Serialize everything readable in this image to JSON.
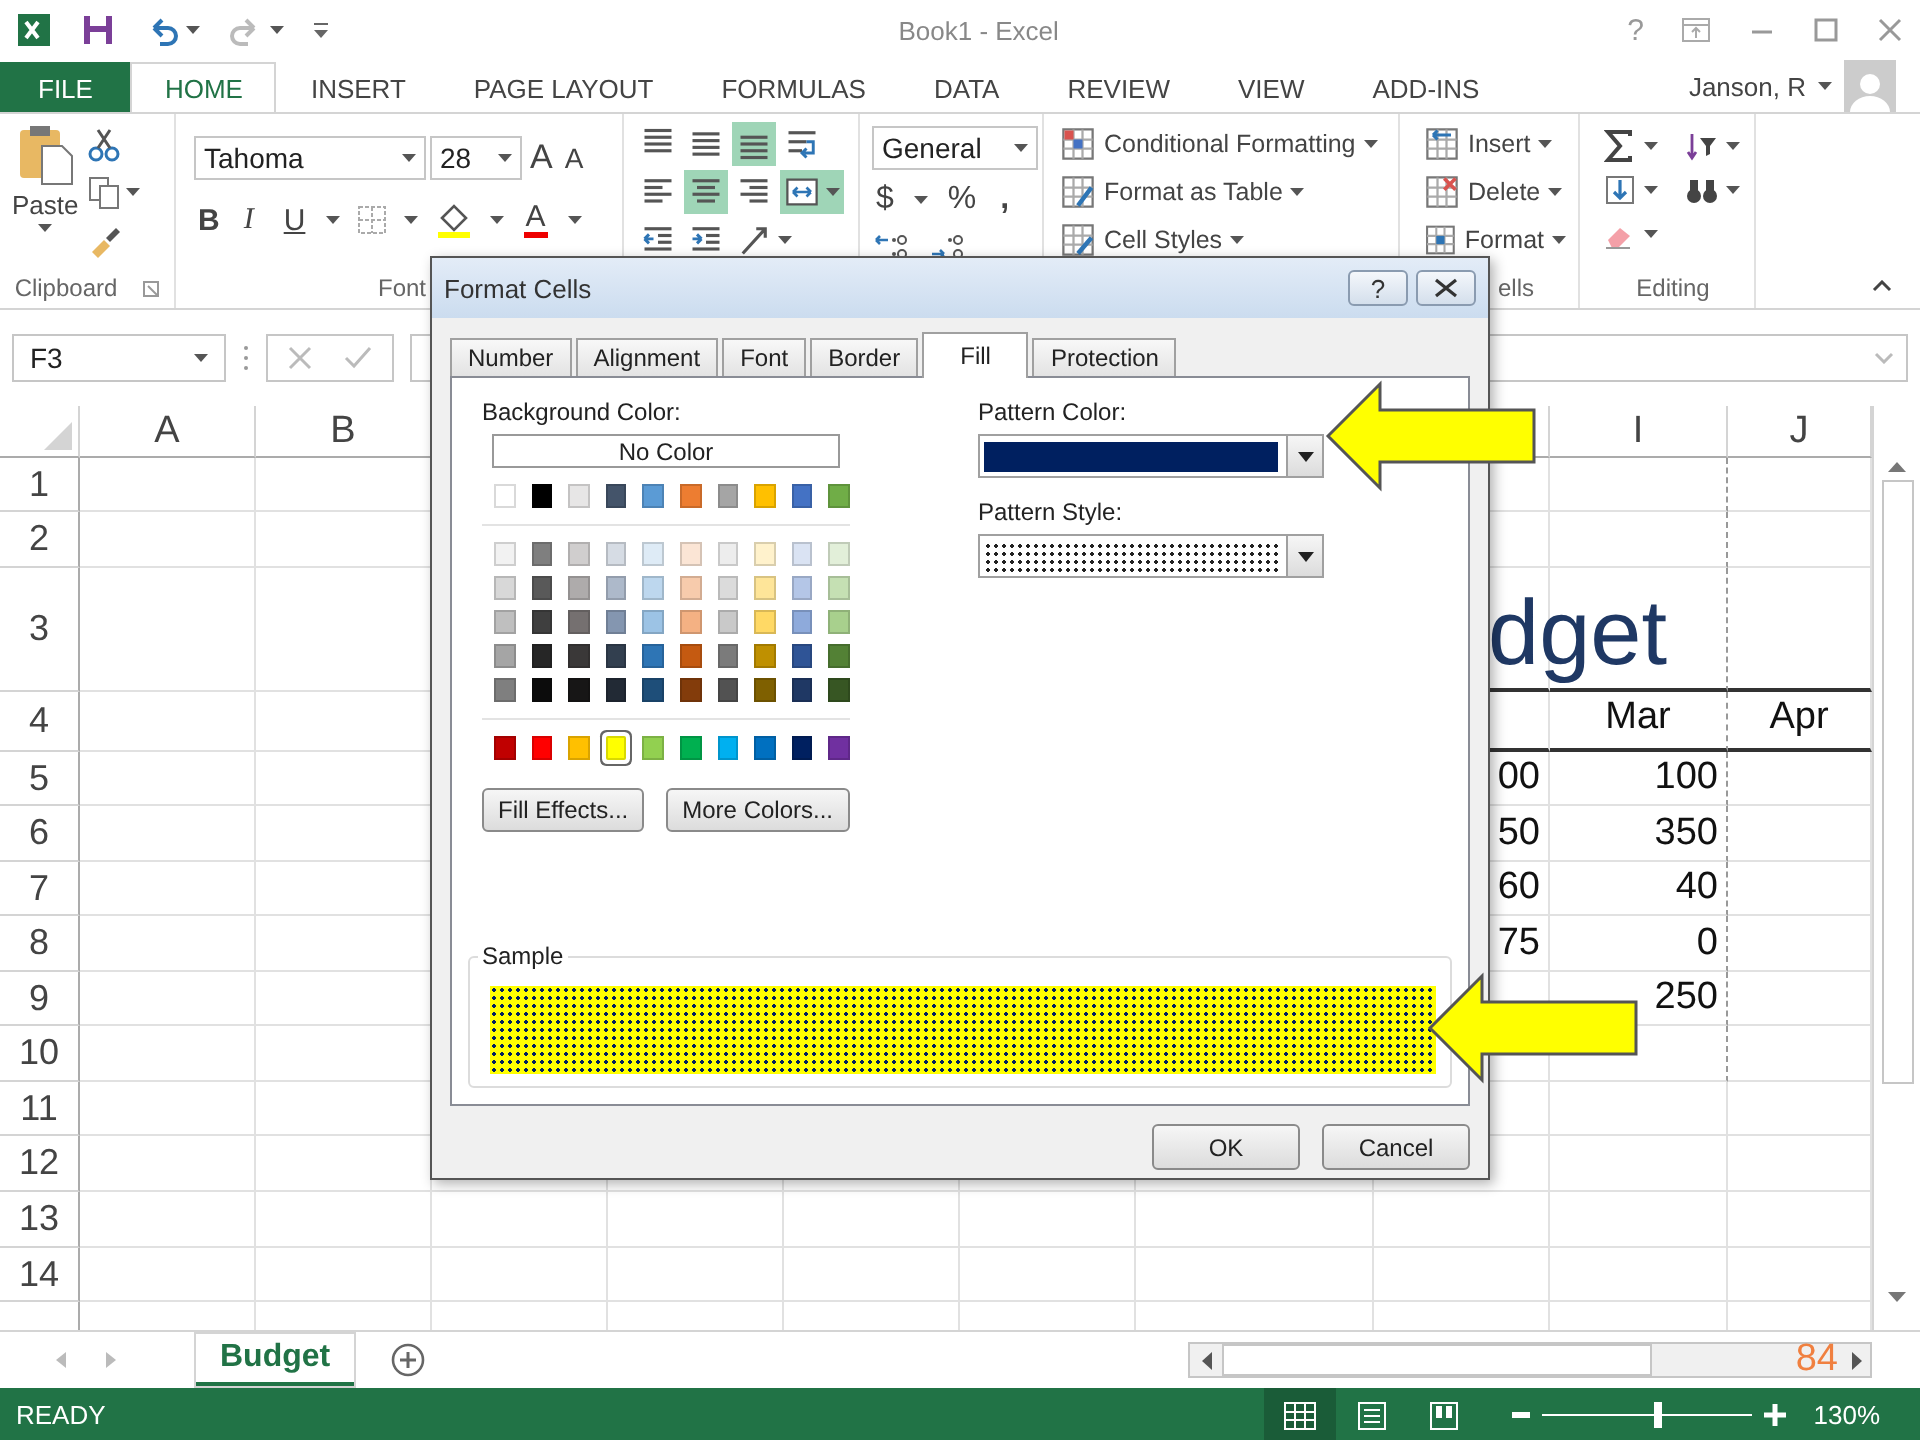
{
  "window": {
    "title": "Book1 - Excel",
    "help": "?"
  },
  "ribbon_tabs": [
    {
      "label": "FILE",
      "kind": "file",
      "selected": false
    },
    {
      "label": "HOME",
      "kind": "tab",
      "selected": true
    },
    {
      "label": "INSERT",
      "kind": "tab",
      "selected": false
    },
    {
      "label": "PAGE LAYOUT",
      "kind": "tab",
      "selected": false
    },
    {
      "label": "FORMULAS",
      "kind": "tab",
      "selected": false
    },
    {
      "label": "DATA",
      "kind": "tab",
      "selected": false
    },
    {
      "label": "REVIEW",
      "kind": "tab",
      "selected": false
    },
    {
      "label": "VIEW",
      "kind": "tab",
      "selected": false
    },
    {
      "label": "ADD-INS",
      "kind": "tab",
      "selected": false
    }
  ],
  "account": {
    "name": "Janson, R"
  },
  "clipboard": {
    "paste_label": "Paste",
    "group_label": "Clipboard"
  },
  "font": {
    "name": "Tahoma",
    "size": "28",
    "grow": "A",
    "shrink": "A",
    "bold": "B",
    "italic": "I",
    "underline": "U",
    "font_color_label": "A",
    "group_label": "Font"
  },
  "alignment": {
    "rows": [
      [
        {
          "kind": "top",
          "selected": false
        },
        {
          "kind": "middle",
          "selected": false
        },
        {
          "kind": "bottom",
          "selected": true
        },
        {
          "kind": "wrap",
          "selected": false
        }
      ],
      [
        {
          "kind": "left",
          "selected": false
        },
        {
          "kind": "center",
          "selected": true
        },
        {
          "kind": "right",
          "selected": false
        },
        {
          "kind": "merge",
          "selected": true
        }
      ],
      [
        {
          "kind": "outdent",
          "selected": false
        },
        {
          "kind": "indent",
          "selected": false
        },
        {
          "kind": "orientation",
          "selected": false
        }
      ]
    ]
  },
  "number": {
    "format": "General",
    "currency": "$",
    "percent": "%",
    "comma": ","
  },
  "styles": {
    "items": [
      {
        "label": "Conditional Formatting",
        "kind": "conditional"
      },
      {
        "label": "Format as Table",
        "kind": "table"
      },
      {
        "label": "Cell Styles",
        "kind": "cellstyle"
      }
    ]
  },
  "cells": {
    "items": [
      {
        "label": "Insert",
        "kind": "insert"
      },
      {
        "label": "Delete",
        "kind": "delete"
      },
      {
        "label": "Format",
        "kind": "format"
      }
    ],
    "group_label": "ells"
  },
  "editing": {
    "group_label": "Editing"
  },
  "formula_bar": {
    "name_box": "F3"
  },
  "sheet": {
    "column_headers": [
      "A",
      "B",
      "I",
      "J"
    ],
    "rows": [
      {
        "header": "1"
      },
      {
        "header": "2"
      },
      {
        "header": "3",
        "kind": "title",
        "H": "dget"
      },
      {
        "header": "4",
        "kind": "heading",
        "I": "Mar",
        "J": "Apr"
      },
      {
        "header": "5",
        "kind": "data",
        "H": "00",
        "I": "100"
      },
      {
        "header": "6",
        "kind": "data",
        "H": "50",
        "I": "350"
      },
      {
        "header": "7",
        "kind": "data",
        "H": "60",
        "I": "40"
      },
      {
        "header": "8",
        "kind": "data",
        "H": "75",
        "I": "0"
      },
      {
        "header": "9",
        "kind": "data",
        "I": "250"
      },
      {
        "header": "10"
      },
      {
        "header": "11"
      },
      {
        "header": "12"
      },
      {
        "header": "13"
      },
      {
        "header": "14"
      }
    ]
  },
  "sheet_tabs": [
    {
      "label": "Budget",
      "selected": true
    }
  ],
  "horizontal_scroll": {
    "text": "84"
  },
  "status_bar": {
    "mode": "READY",
    "views": [
      {
        "kind": "normal",
        "selected": true
      },
      {
        "kind": "page_layout",
        "selected": false
      },
      {
        "kind": "page_break",
        "selected": false
      }
    ],
    "zoom": {
      "level": 0.55,
      "reading": "130%"
    }
  },
  "dialog": {
    "title": "Format Cells",
    "help": "?",
    "tabs": [
      {
        "label": "Number",
        "selected": false
      },
      {
        "label": "Alignment",
        "selected": false
      },
      {
        "label": "Font",
        "selected": false
      },
      {
        "label": "Border",
        "selected": false
      },
      {
        "label": "Fill",
        "selected": true
      },
      {
        "label": "Protection",
        "selected": false
      }
    ],
    "background_color": {
      "label": "Background Color:",
      "no_color": "No Color",
      "groups": [
        {
          "rows": [
            [
              {
                "color": "#ffffff",
                "selected": false
              },
              {
                "color": "#000000",
                "selected": false
              },
              {
                "color": "#e7e6e6",
                "selected": false
              },
              {
                "color": "#44546a",
                "selected": false
              },
              {
                "color": "#5b9bd5",
                "selected": false
              },
              {
                "color": "#ed7d31",
                "selected": false
              },
              {
                "color": "#a5a5a5",
                "selected": false
              },
              {
                "color": "#ffc000",
                "selected": false
              },
              {
                "color": "#4472c4",
                "selected": false
              },
              {
                "color": "#70ad47",
                "selected": false
              }
            ]
          ]
        },
        {
          "rows": [
            [
              {
                "color": "#f2f2f2",
                "selected": false
              },
              {
                "color": "#7f7f7f",
                "selected": false
              },
              {
                "color": "#d0cece",
                "selected": false
              },
              {
                "color": "#d6dce4",
                "selected": false
              },
              {
                "color": "#deebf6",
                "selected": false
              },
              {
                "color": "#fbe5d5",
                "selected": false
              },
              {
                "color": "#ededed",
                "selected": false
              },
              {
                "color": "#fff2cc",
                "selected": false
              },
              {
                "color": "#dae3f3",
                "selected": false
              },
              {
                "color": "#e2efd9",
                "selected": false
              }
            ],
            [
              {
                "color": "#d8d8d8",
                "selected": false
              },
              {
                "color": "#595959",
                "selected": false
              },
              {
                "color": "#aeabab",
                "selected": false
              },
              {
                "color": "#adb9ca",
                "selected": false
              },
              {
                "color": "#bdd7ee",
                "selected": false
              },
              {
                "color": "#f7cbac",
                "selected": false
              },
              {
                "color": "#dbdbdb",
                "selected": false
              },
              {
                "color": "#fee599",
                "selected": false
              },
              {
                "color": "#b4c6e7",
                "selected": false
              },
              {
                "color": "#c5e0b3",
                "selected": false
              }
            ],
            [
              {
                "color": "#bfbfbf",
                "selected": false
              },
              {
                "color": "#3f3f3f",
                "selected": false
              },
              {
                "color": "#757070",
                "selected": false
              },
              {
                "color": "#8496b0",
                "selected": false
              },
              {
                "color": "#9cc3e5",
                "selected": false
              },
              {
                "color": "#f4b183",
                "selected": false
              },
              {
                "color": "#c9c9c9",
                "selected": false
              },
              {
                "color": "#ffd965",
                "selected": false
              },
              {
                "color": "#8eaadb",
                "selected": false
              },
              {
                "color": "#a8d08d",
                "selected": false
              }
            ],
            [
              {
                "color": "#a5a5a5",
                "selected": false
              },
              {
                "color": "#262626",
                "selected": false
              },
              {
                "color": "#3a3838",
                "selected": false
              },
              {
                "color": "#323f4f",
                "selected": false
              },
              {
                "color": "#2e75b5",
                "selected": false
              },
              {
                "color": "#c55a11",
                "selected": false
              },
              {
                "color": "#7b7b7b",
                "selected": false
              },
              {
                "color": "#bf9000",
                "selected": false
              },
              {
                "color": "#2f5496",
                "selected": false
              },
              {
                "color": "#538135",
                "selected": false
              }
            ],
            [
              {
                "color": "#7f7f7f",
                "selected": false
              },
              {
                "color": "#0c0c0c",
                "selected": false
              },
              {
                "color": "#171616",
                "selected": false
              },
              {
                "color": "#222a35",
                "selected": false
              },
              {
                "color": "#1e4e79",
                "selected": false
              },
              {
                "color": "#833c0b",
                "selected": false
              },
              {
                "color": "#525252",
                "selected": false
              },
              {
                "color": "#7f6000",
                "selected": false
              },
              {
                "color": "#1f3864",
                "selected": false
              },
              {
                "color": "#375623",
                "selected": false
              }
            ]
          ]
        },
        {
          "rows": [
            [
              {
                "color": "#c00000",
                "selected": false
              },
              {
                "color": "#ff0000",
                "selected": false
              },
              {
                "color": "#ffc000",
                "selected": false
              },
              {
                "color": "#ffff00",
                "selected": true
              },
              {
                "color": "#92d050",
                "selected": false
              },
              {
                "color": "#00b050",
                "selected": false
              },
              {
                "color": "#00b0f0",
                "selected": false
              },
              {
                "color": "#0070c0",
                "selected": false
              },
              {
                "color": "#002060",
                "selected": false
              },
              {
                "color": "#7030a0",
                "selected": false
              }
            ]
          ]
        }
      ],
      "buttons": [
        "Fill Effects...",
        "More Colors..."
      ]
    },
    "pattern_color": {
      "label": "Pattern Color:",
      "color": "#002060"
    },
    "pattern_style": {
      "label": "Pattern Style:",
      "kind": "dots"
    },
    "sample": {
      "label": "Sample"
    },
    "buttons": [
      "OK",
      "Cancel"
    ]
  }
}
